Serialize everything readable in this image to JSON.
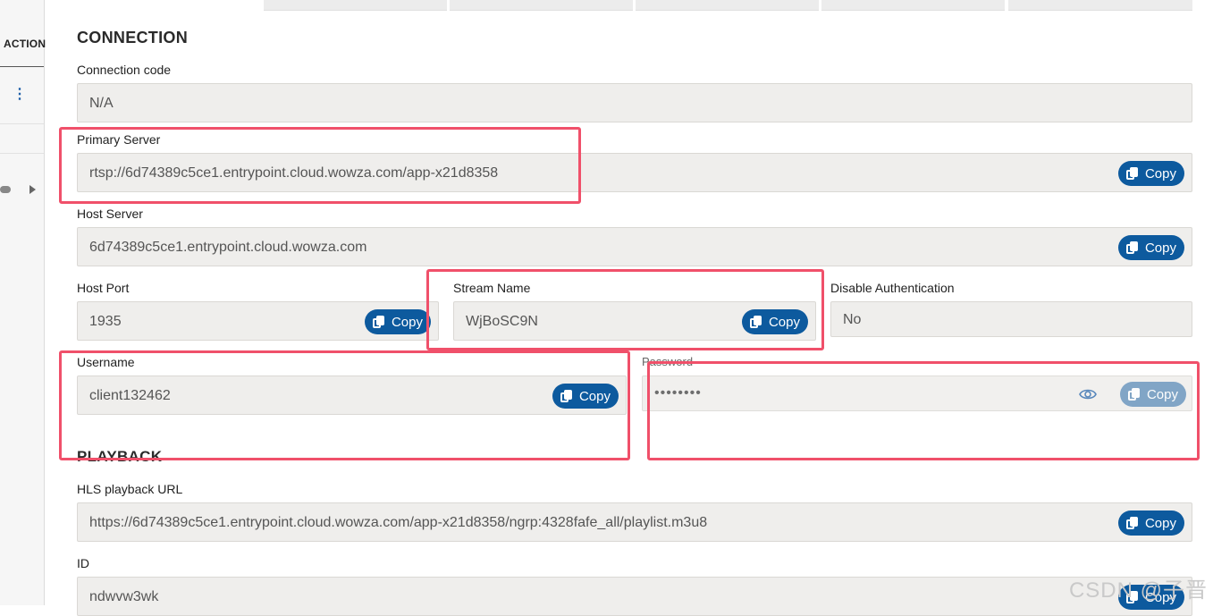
{
  "sidebar": {
    "action_header": "ACTION",
    "menu_icon": "kebab-menu-icon"
  },
  "connection": {
    "title": "CONNECTION",
    "connection_code": {
      "label": "Connection code",
      "value": "N/A"
    },
    "primary_server": {
      "label": "Primary Server",
      "value": "rtsp://6d74389c5ce1.entrypoint.cloud.wowza.com/app-x21d8358"
    },
    "host_server": {
      "label": "Host Server",
      "value": "6d74389c5ce1.entrypoint.cloud.wowza.com"
    },
    "host_port": {
      "label": "Host Port",
      "value": "1935"
    },
    "stream_name": {
      "label": "Stream Name",
      "value": "WjBoSC9N"
    },
    "disable_auth": {
      "label": "Disable Authentication",
      "value": "No"
    },
    "username": {
      "label": "Username",
      "value": "client132462"
    },
    "password": {
      "label": "Password",
      "value": "••••••••"
    }
  },
  "playback": {
    "title": "PLAYBACK",
    "hls_url": {
      "label": "HLS playback URL",
      "value": "https://6d74389c5ce1.entrypoint.cloud.wowza.com/app-x21d8358/ngrp:4328fafe_all/playlist.m3u8"
    },
    "id": {
      "label": "ID",
      "value": "ndwvw3wk"
    }
  },
  "copy_label": "Copy",
  "icons": {
    "copy": "copy-icon",
    "eye": "eye-icon"
  },
  "colors": {
    "button": "#0d5a9e",
    "highlight": "#f0506a",
    "field_bg": "#efeeec"
  },
  "watermark": "CSDN @子晋"
}
